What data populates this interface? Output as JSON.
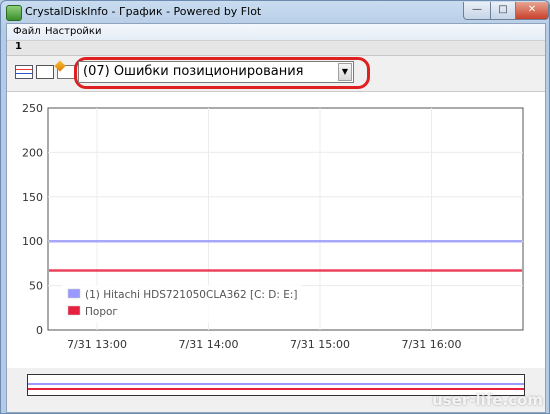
{
  "window": {
    "title": "CrystalDiskInfo - График - Powered by Flot",
    "buttons": {
      "minimize": "—",
      "maximize": "□",
      "close": "✕"
    }
  },
  "menu": {
    "items": [
      {
        "label": "Файл"
      },
      {
        "label": "Настройки"
      }
    ]
  },
  "tab": {
    "label": "1"
  },
  "toolbar": {
    "icons": [
      "chart-icon",
      "blank-icon",
      "chart-folder-icon"
    ],
    "attribute_select": {
      "value": "(07) Ошибки позиционирования"
    }
  },
  "watermark": "user-life.com",
  "chart_data": {
    "type": "line",
    "title": "",
    "xlabel": "",
    "ylabel": "",
    "ylim": [
      0,
      250
    ],
    "yticks": [
      "250",
      "200",
      "150",
      "100",
      "50",
      "0"
    ],
    "xticks": [
      "7/31 13:00",
      "7/31 14:00",
      "7/31 15:00",
      "7/31 16:00"
    ],
    "grid": true,
    "legend_placement": "bottom-left",
    "series": [
      {
        "name": "(1) Hitachi HDS721050CLA362 [C: D: E:]",
        "color": "#9999ff",
        "values": [
          100,
          100
        ]
      },
      {
        "name": "Порог",
        "color": "#e8203f",
        "values": [
          67,
          67
        ]
      }
    ]
  },
  "overview_data": {
    "series": [
      {
        "color": "#9999ff",
        "value": 100
      },
      {
        "color": "#e8203f",
        "value": 67
      }
    ],
    "ylim": [
      0,
      250
    ]
  }
}
